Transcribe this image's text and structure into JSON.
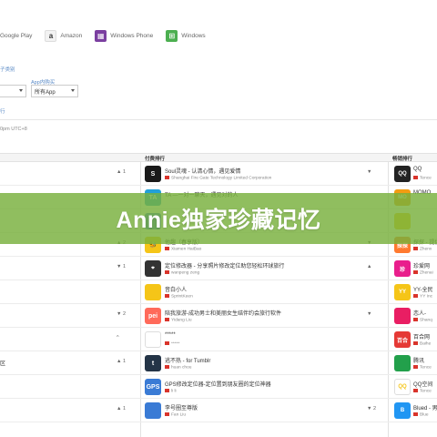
{
  "platforms": [
    {
      "label": "Google Play",
      "icon": "google-play-icon",
      "color": "#ffffff"
    },
    {
      "label": "Amazon",
      "icon": "amazon-icon",
      "color": "#f2f2f2"
    },
    {
      "label": "Windows Phone",
      "icon": "windows-phone-icon",
      "color": "#7b3fa0"
    },
    {
      "label": "Windows",
      "icon": "windows-icon",
      "color": "#4caf50"
    }
  ],
  "filters": {
    "label_1": "子类别",
    "label_2": "App内购买",
    "select_1": "",
    "select_2": "所有App",
    "line_label": "行",
    "timezone": "0pm UTC+8"
  },
  "table": {
    "headers": {
      "col2": "付费排行",
      "col3": "畅销排行"
    },
    "rows": [
      {
        "c1_text": "",
        "c1_trend": "▲ 1",
        "c2_icon_text": "S",
        "c2_icon_color": "#1a1a1a",
        "c2_title": "Soul灵魂 - 认清心情，遇见爱情",
        "c2_sub": "Shanghai Fire Gate Technology Limited Corporation",
        "c2_trend": "▼",
        "c3_icon_text": "QQ",
        "c3_icon_color": "#222222",
        "c3_title": "QQ",
        "c3_sub": "Tence"
      },
      {
        "c1_text": "",
        "c1_trend": "",
        "c2_icon_text": "TA",
        "c2_icon_color": "#22a0d8",
        "c2_title": "TA —一对一聊天，遇见对的人",
        "c2_sub": "",
        "c2_trend": "",
        "c3_icon_text": "MO",
        "c3_icon_color": "#f39c12",
        "c3_title": "MOMO",
        "c3_sub": ""
      },
      {
        "c1_text": "",
        "c1_trend": "",
        "c2_icon_text": "",
        "c2_icon_color": "#3a7bd5",
        "c2_title": "",
        "c2_sub": "",
        "c2_trend": "",
        "c3_icon_text": "",
        "c3_icon_color": "#f5c518",
        "c3_title": "",
        "c3_sub": ""
      },
      {
        "c1_text": "",
        "c1_trend": "▲ 2",
        "c2_icon_text": "🐝",
        "c2_icon_color": "#f5c518",
        "c2_title": "他趣（春享版）",
        "c2_sub": "Xiamen HaiBao",
        "c2_trend": "▼",
        "c3_icon_text": "探探",
        "c3_icon_color": "#ff7a2f",
        "c3_title": "探探 - 提供",
        "c3_sub": "Zhenx"
      },
      {
        "c1_text": "",
        "c1_trend": "▼ 1",
        "c2_icon_text": "⌖",
        "c2_icon_color": "#333333",
        "c2_title": "定位修改器 - 分享照片修改定位助您轻松环球旅行",
        "c2_sub": "wanpeng zeng",
        "c2_trend": "▲",
        "c3_icon_text": "珍",
        "c3_icon_color": "#e91e8c",
        "c3_title": "珍爱网",
        "c3_sub": "Zhenai"
      },
      {
        "c1_text": "",
        "c1_trend": "",
        "c2_icon_text": "",
        "c2_icon_color": "#f5c518",
        "c2_title": "音白小人",
        "c2_sub": "SprintKeen",
        "c2_trend": "",
        "c3_icon_text": "YY",
        "c3_icon_color": "#f5c518",
        "c3_title": "YY-全民",
        "c3_sub": "YY Inc"
      },
      {
        "c1_text": "",
        "c1_trend": "▼ 2",
        "c2_icon_text": "pei",
        "c2_icon_color": "#ff6a5a",
        "c2_title": "陪我旅游-成功男士和美丽女生结伴约会旅行软件",
        "c2_sub": "Yidang Liu",
        "c2_trend": "▼",
        "c3_icon_text": "",
        "c3_icon_color": "#e91e63",
        "c3_title": "恋人-",
        "c3_sub": "Shanq"
      },
      {
        "c1_text": "",
        "c1_trend": "^",
        "c2_icon_text": "",
        "c2_icon_color": "#ffffff",
        "c2_title": "*****",
        "c2_sub": "*****",
        "c2_trend": "",
        "c3_icon_text": "百合",
        "c3_icon_color": "#e53935",
        "c3_title": "百合网",
        "c3_sub": "Baihe"
      },
      {
        "c1_text": "区",
        "c1_trend": "▲ 1",
        "c2_icon_text": "t",
        "c2_icon_color": "#243447",
        "c2_title": "逃不热 - for Tumblr",
        "c2_sub": "huan chou",
        "c2_trend": "",
        "c3_icon_text": "",
        "c3_icon_color": "#22a04b",
        "c3_title": "腾讯",
        "c3_sub": "Tence"
      },
      {
        "c1_text": "",
        "c1_trend": "",
        "c2_icon_text": "GPS",
        "c2_icon_color": "#3a7bd5",
        "c2_title": "GPS修改定位器-定位置到朋友圈的定位神器",
        "c2_sub": "li li",
        "c2_trend": "",
        "c3_icon_text": "QQ",
        "c3_icon_color": "#ffffff",
        "c3_title": "QQ空间",
        "c3_sub": "Tence"
      },
      {
        "c1_text": "",
        "c1_trend": "▲ 1",
        "c2_icon_text": "",
        "c2_icon_color": "#3a7bd5",
        "c2_title": "李号圈至尊版",
        "c2_sub": "Fan Liu",
        "c2_trend": "▼ 2",
        "c3_icon_text": "B",
        "c3_icon_color": "#2196f3",
        "c3_title": "Blued - 男",
        "c3_sub": "Blue"
      }
    ]
  },
  "watermark": {
    "text": "Annie独家珍藏记忆",
    "color": "#78b03c"
  }
}
